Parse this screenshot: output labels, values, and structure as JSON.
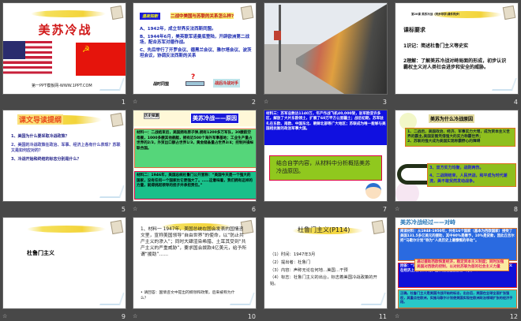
{
  "slides": [
    {
      "number": "1",
      "title": "美苏冷战",
      "footer": "第一PPT模板网-WWW.1PPT.COM"
    },
    {
      "number": "2",
      "tag": "温故知新",
      "question": "二战中美国与苏联的关系怎么样?",
      "items": [
        "A、1942年，成立世界反法西斯同盟。",
        "B、1944年6月，美英联军诺曼底登陆，开辟欧洲第二战场，配合苏军对德作战。",
        "C、先后举行了开罗会议、德黑兰会议、雅尔塔会议、波茨坦会议，协调反法西斯的关系"
      ],
      "left_label": "战时同盟",
      "mark": "?",
      "right_label": "战后冷战对手"
    },
    {
      "number": "3"
    },
    {
      "number": "4",
      "header": "第20课  美苏冷战（同步导学\\课件同步）",
      "heading": "课标要求",
      "items": [
        "1识记：简述杜鲁门主义等史实",
        "2理解：了解美苏冷战对峙局面的形成，初步认识霸权主义对人类社会进步和安全的威胁。"
      ]
    },
    {
      "number": "5",
      "title": "课文导读提纲",
      "items": [
        "1、美国为什么要采取冷战政策？",
        "2、美国的冷战政策在政治、军事、经济上各有什么表现？苏联又是如何应对的？",
        "3、冷战开始和终结的标志分别是什么？"
      ]
    },
    {
      "number": "6",
      "tag": "历史探源",
      "title": "美苏冷战——原因",
      "material1": "材料一：二战结束后，美国拥有原子弹,拥有1200多万军队，30艘航空母舰，1000多艘其他舰艇，拥有近500个海外军事基地；工业生产量占世界的2/3，外贸出口额占世界1/3，黄金储备量占世界3/4；控制并操纵联合国。",
      "material2": "材料二：1946年，美国总统杜鲁门公开宣称：“美国今天是一个强大的国家，没有任何一个国家比它更强大了。……这意味着，我们拥有这样的力量，就得挑起领导的担子并承担责任。”"
    },
    {
      "number": "7",
      "material3": "材料三：苏军总数达1140万，年产作战飞机40,000架，驻军欧亚许多区，解放了大片东欧领土，扩展了60万平方公里疆土；战后初期，苏军驻扎在东欧、南欧、中国东北、朝鲜北部等广大地区；苏联成为唯一能够与美国相抗衡的政治军事大国。",
      "prompt": "结合自学内容，从材料中分析概括美苏冷战原因。"
    },
    {
      "number": "8",
      "title": "美苏为什么冷战原因",
      "box1": [
        "1、二战后，美国政治、经济、军事实力大增，成为资本主义世界的霸主,美国妄图凭借强大的实力称霸世界；",
        "2、苏联的强大成为美国实现称霸野心的障碍"
      ],
      "box2": [
        "3、双方实力均衡，战则两伤。",
        "4、二战刚结束，人民厌战，和平成为时代潮流，美不敢贸然发动战争。"
      ]
    },
    {
      "number": "9",
      "title": "杜鲁门主义"
    },
    {
      "number": "10",
      "paragraph": "1、材料一  1947年，美国总统在国会发表的国情咨文里，宣称美国领导“自由世界”的使命，以“防止共产主义的渗入”；同时大肆渲染希腊、土耳其受到“共产主义的严重威胁”，要求国会拨款4亿美元，给予所谓“援助”……",
      "bullet": "请回答：国情咨文中提出的纲领和政策，后来被称为什么？"
    },
    {
      "number": "11",
      "title": "杜鲁门主义(P114)",
      "items": [
        "（1）时间：1947年3月",
        "（2）提出者：杜鲁门",
        "（3）内容：声称无论在何地…美国…干预",
        "（4）标志：杜鲁门主义的出台，标志着美国冷战政策的开始。"
      ]
    },
    {
      "number": "12",
      "title": "美苏冷战经过——对峙",
      "reading": "阅读材料：从1948-1950年，共有16个国家（基本为西欧国家）接受了美国131.5多亿美元的援助，其中90%是赠予，10%是贷款，因此丘吉尔把“马歇尔计划”称为“人类历史上最慷慨的举动”。",
      "overlay": "通过援助西欧恢复经济，稳定资本主义制度；同时加强美国对西欧的控制，以对抗苏联为首的社会主义力量",
      "question": "回答：“马歇尔计划”的实质是什么？ 2、有人说马歇尔计划是杜鲁门主义在经济上的具体体现，这种说法是否正确？为什么？",
      "answer": "正确。杜鲁门主义是美国冷战开始的标志，出台后，美国在全球全面扩张强权，其重点在欧洲，实施马歇尔计划使美国实现在欧洲政治领域扩张的经济手段。"
    }
  ],
  "colors": {
    "background": "#484848",
    "title_red": "#d01818",
    "blue": "#1a1ad8",
    "green_box": "#55d67a",
    "olive": "#7ab51d"
  }
}
